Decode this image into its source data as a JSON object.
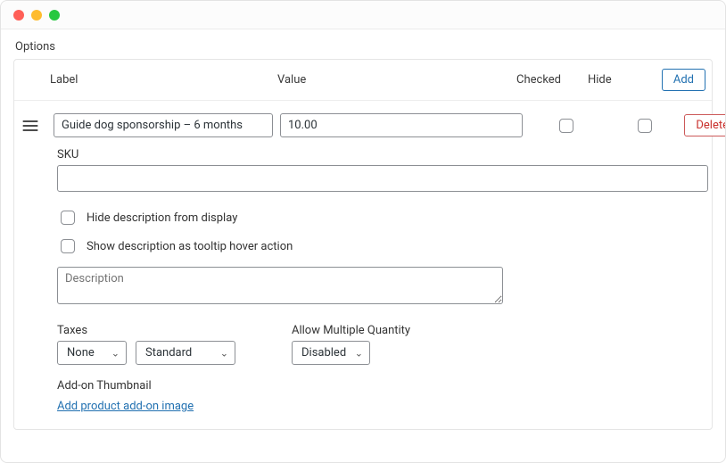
{
  "section_title": "Options",
  "headers": {
    "label": "Label",
    "value": "Value",
    "checked": "Checked",
    "hide": "Hide"
  },
  "buttons": {
    "add": "Add",
    "delete": "Delete"
  },
  "row": {
    "label_value": "Guide dog sponsorship – 6 months",
    "value_value": "10.00"
  },
  "sku": {
    "label": "SKU",
    "value": ""
  },
  "checkboxes": {
    "hide_description": "Hide description from display",
    "tooltip_description": "Show description as tooltip hover action"
  },
  "description_placeholder": "Description",
  "taxes": {
    "label": "Taxes",
    "sel1": "None",
    "sel2": "Standard"
  },
  "multiple": {
    "label": "Allow Multiple Quantity",
    "sel": "Disabled"
  },
  "thumbnail": {
    "label": "Add-on Thumbnail",
    "link": "Add product add-on image"
  }
}
